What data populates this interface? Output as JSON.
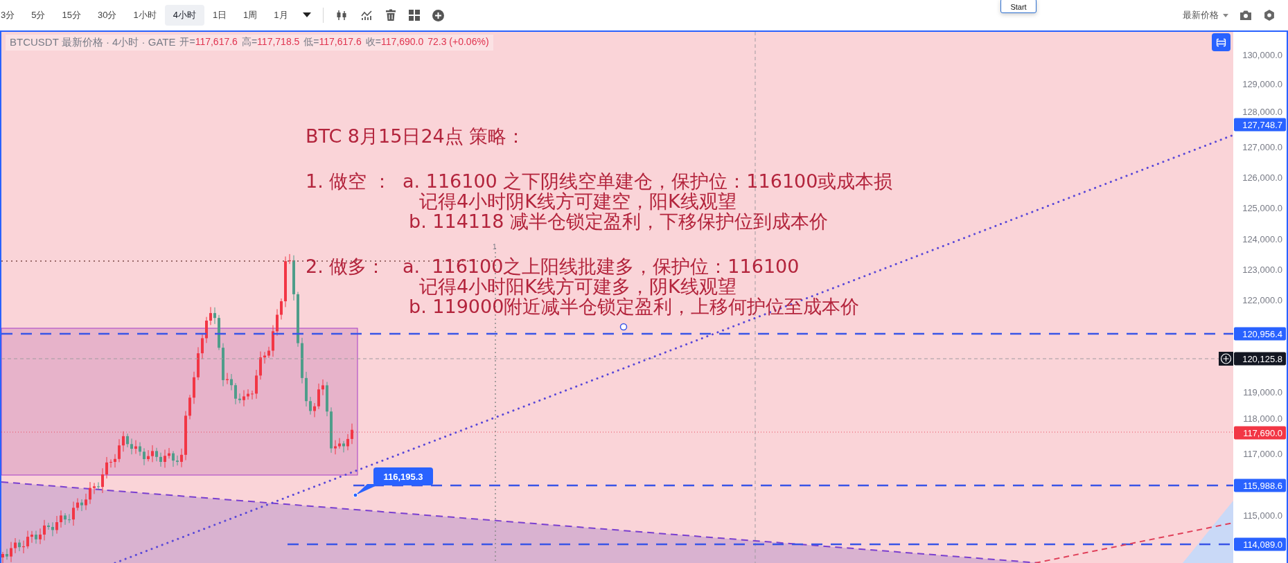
{
  "toolbar": {
    "intervals": [
      {
        "label": "3分",
        "selected": false
      },
      {
        "label": "5分",
        "selected": false
      },
      {
        "label": "15分",
        "selected": false
      },
      {
        "label": "30分",
        "selected": false
      },
      {
        "label": "1小时",
        "selected": false
      },
      {
        "label": "4小时",
        "selected": true
      },
      {
        "label": "1日",
        "selected": false
      },
      {
        "label": "1周",
        "selected": false
      },
      {
        "label": "1月",
        "selected": false
      }
    ],
    "price_source": "最新价格"
  },
  "start_button": "Start",
  "legend": {
    "symbol": "BTCUSDT 最新价格 · 4小时 · GATE",
    "fields": [
      {
        "label": "开=",
        "value": "117,617.6"
      },
      {
        "label": "高=",
        "value": "117,718.5"
      },
      {
        "label": "低=",
        "value": "117,617.6"
      },
      {
        "label": "收=",
        "value": "117,690.0"
      }
    ],
    "change": "72.3 (+0.06%)"
  },
  "annotation": {
    "title": "BTC 8月15日24点 策略：",
    "lines": [
      {
        "kind": "item",
        "label": "1. 做空 ：",
        "text": "a. 116100 之下阴线空单建仓，保护位：116100或成本损"
      },
      {
        "kind": "note",
        "text": "记得4小时阴K线方可建空，阳K线观望"
      },
      {
        "kind": "sub",
        "text": "b. 114118 减半仓锁定盈利，下移保护位到成本价"
      },
      {
        "kind": "item",
        "label": "2. 做多：",
        "text": "a.  116100之上阳线批建多，保护位：116100"
      },
      {
        "kind": "note",
        "text": "记得4小时阳K线方可建多，阴K线观望"
      },
      {
        "kind": "sub",
        "text": "b. 119000附近减半仓锁定盈利，上移何护位至成本价"
      }
    ]
  },
  "marker_label": "1",
  "callout": "116,195.3",
  "price_axis": [
    {
      "kind": "tick",
      "text": "130,000.0"
    },
    {
      "kind": "tick",
      "text": "129,000.0"
    },
    {
      "kind": "tick",
      "text": "128,000.0"
    },
    {
      "kind": "badge",
      "text": "127,748.7",
      "color": "#2962ff"
    },
    {
      "kind": "tick",
      "text": "127,000.0"
    },
    {
      "kind": "tick",
      "text": "126,000.0"
    },
    {
      "kind": "tick",
      "text": "125,000.0"
    },
    {
      "kind": "tick",
      "text": "124,000.0"
    },
    {
      "kind": "tick",
      "text": "123,000.0"
    },
    {
      "kind": "tick",
      "text": "122,000.0"
    },
    {
      "kind": "badge",
      "text": "120,956.4",
      "color": "#2962ff"
    },
    {
      "kind": "badge",
      "text": "120,125.8",
      "color": "#131722"
    },
    {
      "kind": "tick",
      "text": "119,000.0"
    },
    {
      "kind": "tick",
      "text": "118,000.0"
    },
    {
      "kind": "badge",
      "text": "117,690.0",
      "color": "#f23645"
    },
    {
      "kind": "tick",
      "text": "117,000.0"
    },
    {
      "kind": "badge",
      "text": "115,988.6",
      "color": "#2962ff"
    },
    {
      "kind": "tick",
      "text": "115,000.0"
    },
    {
      "kind": "badge",
      "text": "114,089.0",
      "color": "#2962ff"
    }
  ]
}
